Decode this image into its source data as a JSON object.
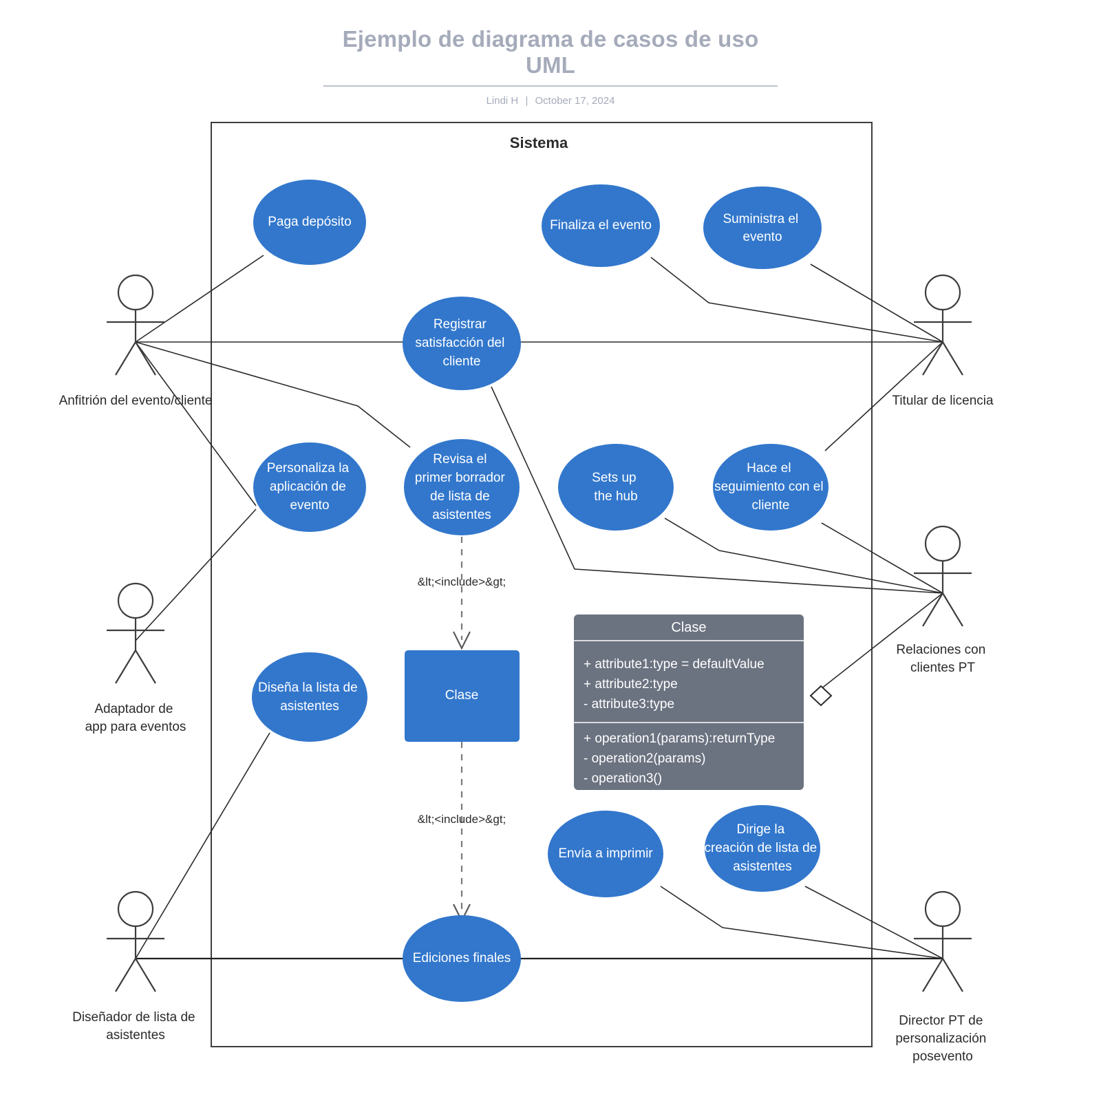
{
  "header": {
    "title": "Ejemplo de diagrama de casos de uso UML",
    "author": "Lindi H",
    "separator": "|",
    "date": "October 17, 2024"
  },
  "diagram": {
    "boundary_title": "Sistema",
    "include_label_top": "&lt;<include>&gt;",
    "include_label_bottom": "&lt;<include>&gt;",
    "colors": {
      "usecase_fill": "#3277cc",
      "class_fill": "#6b7280",
      "line": "#2b2b2b",
      "title_text": "#a5abba"
    },
    "use_cases": [
      {
        "id": "paga-deposito",
        "lines": [
          "Paga depósito"
        ]
      },
      {
        "id": "finaliza-el-evento",
        "lines": [
          "Finaliza el evento"
        ]
      },
      {
        "id": "suministra-el-evento",
        "lines": [
          "Suministra el",
          "evento"
        ]
      },
      {
        "id": "registrar-satisfaccion",
        "lines": [
          "Registrar",
          "satisfacción del",
          "cliente"
        ]
      },
      {
        "id": "personaliza-aplicacion",
        "lines": [
          "Personaliza la",
          "aplicación de",
          "evento"
        ]
      },
      {
        "id": "revisa-primer-borrador",
        "lines": [
          "Revisa el",
          "primer borrador",
          "de lista de",
          "asistentes"
        ]
      },
      {
        "id": "sets-up-the-hub",
        "lines": [
          "Sets up",
          "the hub"
        ]
      },
      {
        "id": "hace-seguimiento",
        "lines": [
          "Hace el",
          "seguimiento con el",
          "cliente"
        ]
      },
      {
        "id": "disena-lista",
        "lines": [
          "Diseña la lista de",
          "asistentes"
        ]
      },
      {
        "id": "envia-a-imprimir",
        "lines": [
          "Envía a imprimir"
        ]
      },
      {
        "id": "dirige-creacion-lista",
        "lines": [
          "Dirige la",
          "creación de lista de",
          "asistentes"
        ]
      },
      {
        "id": "ediciones-finales",
        "lines": [
          "Ediciones finales"
        ]
      }
    ],
    "class_node": {
      "id": "clase-node",
      "label": "Clase"
    },
    "actors": [
      {
        "id": "anfitrion",
        "lines": [
          "Anfitrión del evento/cliente"
        ]
      },
      {
        "id": "adaptador",
        "lines": [
          "Adaptador de",
          "app para eventos"
        ]
      },
      {
        "id": "disenador",
        "lines": [
          "Diseñador de lista de",
          "asistentes"
        ]
      },
      {
        "id": "titular",
        "lines": [
          "Titular de licencia"
        ]
      },
      {
        "id": "relaciones-pt",
        "lines": [
          "Relaciones con",
          "clientes PT"
        ]
      },
      {
        "id": "director-pt",
        "lines": [
          "Director PT de",
          "personalización",
          "posevento"
        ]
      }
    ],
    "class_box": {
      "title": "Clase",
      "attributes": [
        "+ attribute1:type = defaultValue",
        "+ attribute2:type",
        "- attribute3:type"
      ],
      "operations": [
        "+ operation1(params):returnType",
        "- operation2(params)",
        "- operation3()"
      ]
    }
  }
}
